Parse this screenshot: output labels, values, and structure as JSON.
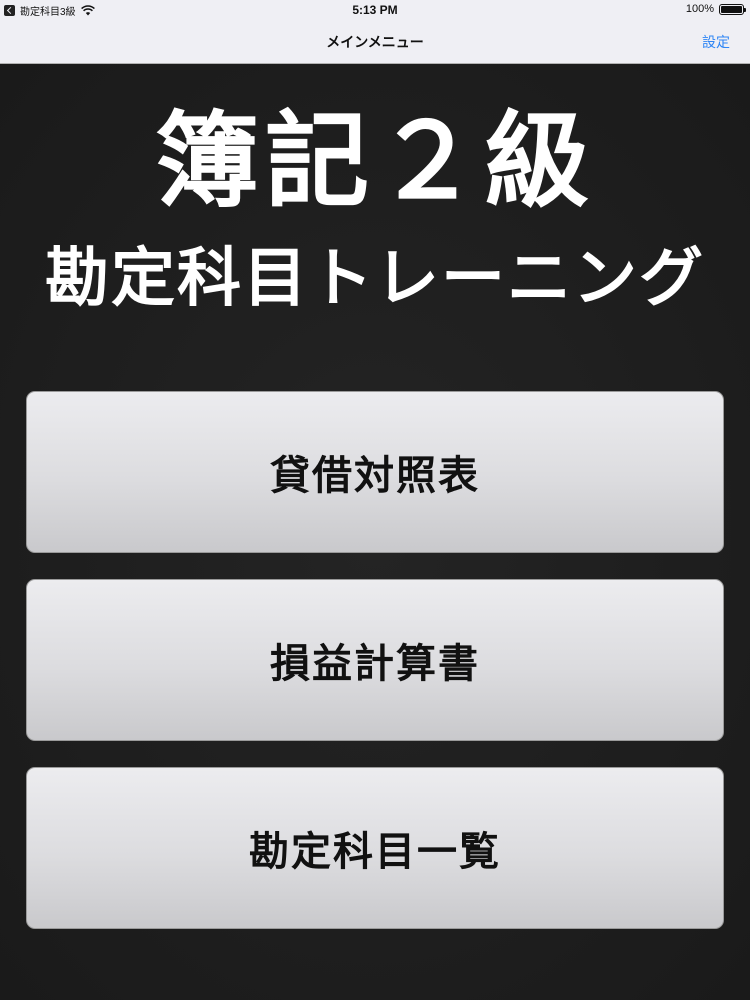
{
  "status_bar": {
    "app_name": "勘定科目3級",
    "time": "5:13 PM",
    "battery": "100%",
    "battery_level": 1.0
  },
  "nav": {
    "title": "メインメニュー",
    "settings_label": "設定",
    "settings_color": "#2f86f5"
  },
  "main": {
    "title": "簿記２級",
    "subtitle": "勘定科目トレーニング",
    "buttons": [
      {
        "label": "貸借対照表"
      },
      {
        "label": "損益計算書"
      },
      {
        "label": "勘定科目一覧"
      }
    ]
  }
}
